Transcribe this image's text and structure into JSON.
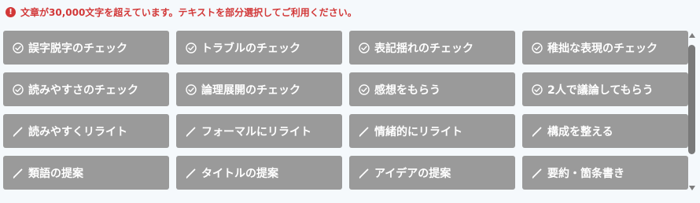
{
  "warning": {
    "icon": "exclamation-icon",
    "text": "文章が30,000文字を超えています。テキストを部分選択してご利用ください。",
    "color": "#d23838"
  },
  "buttons": [
    {
      "icon": "check-circle-icon",
      "label": "誤字脱字のチェック"
    },
    {
      "icon": "check-circle-icon",
      "label": "トラブルのチェック"
    },
    {
      "icon": "check-circle-icon",
      "label": "表記揺れのチェック"
    },
    {
      "icon": "check-circle-icon",
      "label": "稚拙な表現のチェック"
    },
    {
      "icon": "check-circle-icon",
      "label": "読みやすさのチェック"
    },
    {
      "icon": "check-circle-icon",
      "label": "論理展開のチェック"
    },
    {
      "icon": "check-circle-icon",
      "label": "感想をもらう"
    },
    {
      "icon": "check-circle-icon",
      "label": "2人で議論してもらう"
    },
    {
      "icon": "pen-icon",
      "label": "読みやすくリライト"
    },
    {
      "icon": "pen-icon",
      "label": "フォーマルにリライト"
    },
    {
      "icon": "pen-icon",
      "label": "情緒的にリライト"
    },
    {
      "icon": "pen-icon",
      "label": "構成を整える"
    },
    {
      "icon": "pen-icon",
      "label": "類語の提案"
    },
    {
      "icon": "pen-icon",
      "label": "タイトルの提案"
    },
    {
      "icon": "pen-icon",
      "label": "アイデアの提案"
    },
    {
      "icon": "pen-icon",
      "label": "要約・箇条書き"
    }
  ],
  "colors": {
    "button_bg": "#9a9a9a",
    "button_text": "#ffffff",
    "page_bg": "#f5f9fc"
  }
}
